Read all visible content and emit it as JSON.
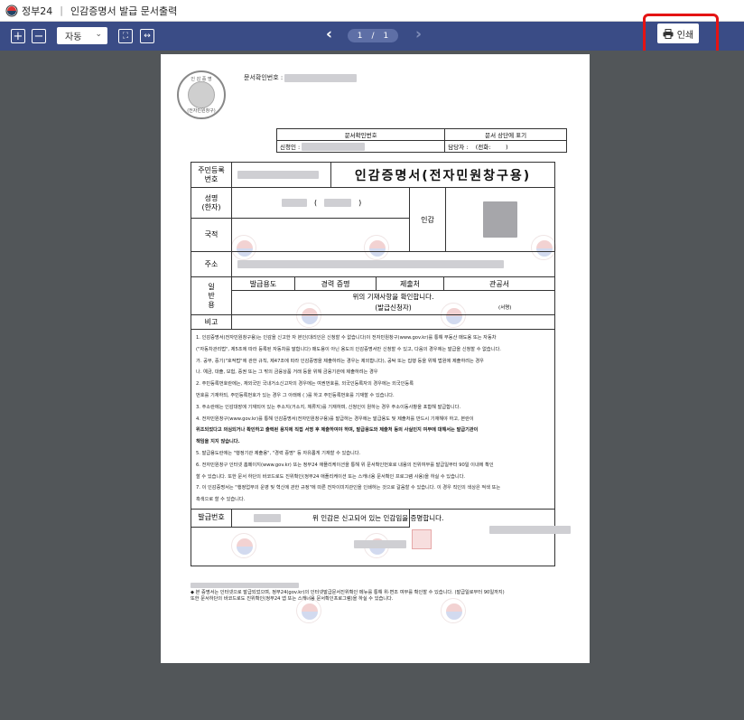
{
  "window": {
    "app_name": "정부24",
    "doc_title": "인감증명서 발급 문서출력"
  },
  "toolbar": {
    "zoom_in_icon": "plus-square-icon",
    "zoom_out_icon": "minus-square-icon",
    "zoom_value": "자동",
    "fit_page_icon": "fit-page-icon",
    "fit_width_icon": "fit-width-icon",
    "page_current": "1",
    "page_separator": "/",
    "page_total": "1",
    "print_label": "인쇄",
    "print_icon": "printer-icon",
    "highlight_color": "#e41313",
    "bar_color": "#3a4c86"
  },
  "document": {
    "doc_confirm_label": "문서확인번호 :",
    "seal_top": "인 감 증 명",
    "seal_bottom": "(전자민원창구)",
    "info_header_1": "문서확인번호",
    "info_header_2": "문서 상단에 표기",
    "applicant_label": "신청인 :",
    "contact_label": "담당자 :",
    "phone_label": "(전화:",
    "phone_close": ")",
    "rrn_label": "주민등록\n번호",
    "title": "인감증명서(전자민원창구용)",
    "name_label": "성명\n(한자)",
    "paren_open": "(",
    "paren_close": ")",
    "seal_label": "인감",
    "nationality_label": "국적",
    "address_label": "주소",
    "usage_label": "일\n반\n용",
    "usage_col1": "발급용도",
    "usage_col2": "경력 증명",
    "usage_col3": "제출처",
    "usage_col4": "관공서",
    "confirm_text": "위의 기재사항을 확인합니다.",
    "applicant_sign": "(발급신청자)",
    "sign_mark": "(서명)",
    "remarks_label": "비고",
    "notes": [
      "1. 인감증명서(전자민원창구용)는 인감을 신고한 자 본인(대리인은 신청할 수 없습니다)이 전자민원창구(www.gov.kr)를 통해 부동산 매도용 또는 자동차",
      "(\"자동차관리법\", 제5조에 따라 등록된 자동차를 말합니다) 매도용이 아닌 용도의 인감증명서만 신청할 수 있고, 다음의 경우에는 발급을 신청할 수 없습니다.",
      "가. 공무, 증기(\"호적법\"에 관한 규칙, 제47조에 따라 인감증명을 제출하려는 경우는 제외합니다), 공탁 또는 집행 등을 위해 법원에 제출하려는 경우",
      "나. 예금, 대출, 보험, 증권 또는 그 밖의 금융상품 거래 등을 위해 금융기관에 제출하려는 경우",
      "2. 주민등록번호란에는, 재외국민 국내거소신고자의 경우에는 여권번호를, 외국인등록자의 경우에는 외국인등록",
      "번호를 기재하되, 주민등록번호가 있는 경우 그 아래에 ( )를 하고 주민등록번호를 기재할 수 있습니다.",
      "3. 주소란에는 인감대장에 기재되어 있는 주소지(거소지, 체류지)를 기재하며, 신청인이 원하는 경우 주소이동사항을 포함해 발급합니다.",
      "4. 전자민원창구(www.gov.kr)를 통해 인감증명서(전자민원창구용)를 발급하는 경우에는 발급용도 및 제출처를 반드시 기재해야 하고, 본란이",
      "위조되었다고 의심되거나 확인하고 출력된 용지에 직접 서명 후 제출하여야 하며, 발급용도와 제출처 등의 사실인지 여부에 대해서는 발급기관이",
      "책임을 지지 않습니다.",
      "5. 발급용도란에는 \"행정기관 제출용\", \"경력 증명\" 등 자유롭게 기재할 수 있습니다.",
      "6. 전자민원창구 인터넷 홈페이지(www.gov.kr) 또는 정부24 애플리케이션을 통해 위 문서확인번호로 내용의 진위여부를 발급일부터 90일 이내에 확인",
      "할 수 있습니다. 또한 문서 하단의 바코드로도 진위확인(정부24 애플리케이션 또는 스캐너용 문서확인 프로그램 사용)을 하실 수 있습니다.",
      "7. 이 인감증명서는 \"행정업무의 운영 및 혁신에 관한 규정\"에 따른 전자이미지관인을 인쇄하는 것으로 갈음할 수 있습니다. 이 경우 직인의 색상은 적색 또는",
      "흑색으로 할 수 있습니다."
    ],
    "issue_no_label": "발급번호",
    "certify_text": "위 인감은 신고되어 있는 인감임을 증명합니다.",
    "footnote_1": "◆ 본 증명서는 인터넷으로 발급되었으며, 정부24(gov.kr)의 인터넷발급문서진위확인 메뉴를 통해 위·변조 여부를 확인할 수 있습니다. (발급일로부터 90일까지)",
    "footnote_2": "또한 문서하단의 바코드로도 진위확인(정부24 앱 또는 스캐너용 문서확인프로그램)을 하실 수 있습니다."
  }
}
